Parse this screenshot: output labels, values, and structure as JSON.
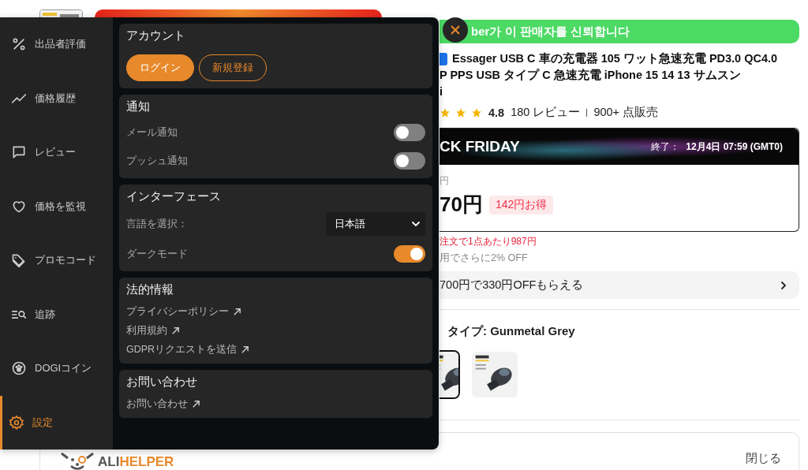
{
  "sidebar": {
    "items": [
      {
        "label": "出品者評価",
        "kind": "percent",
        "selected": false
      },
      {
        "label": "価格履歴",
        "kind": "chart",
        "selected": false
      },
      {
        "label": "レビュー",
        "kind": "chat",
        "selected": false
      },
      {
        "label": "価格を監視",
        "kind": "heart",
        "selected": false
      },
      {
        "label": "プロモコード",
        "kind": "tag",
        "selected": false
      },
      {
        "label": "追跡",
        "kind": "track",
        "selected": false
      },
      {
        "label": "DOGIコイン",
        "kind": "coin",
        "selected": false
      },
      {
        "label": "設定",
        "kind": "gear",
        "selected": true
      }
    ]
  },
  "account": {
    "title": "アカウント",
    "buttons": [
      {
        "label": "ログイン",
        "kind": "primary"
      },
      {
        "label": "新規登録",
        "kind": "outline"
      }
    ]
  },
  "notifications": {
    "title": "通知",
    "toggles": [
      {
        "label": "メール通知",
        "on": false
      },
      {
        "label": "プッシュ通知",
        "on": false
      }
    ]
  },
  "interface": {
    "title": "インターフェース",
    "language": {
      "label": "言語を選択：",
      "value": "日本語"
    },
    "dark_mode": {
      "label": "ダークモード",
      "on": true
    }
  },
  "legal": {
    "title": "法的情報",
    "links": [
      "プライバシーポリシー",
      "利用規約",
      "GDPRリクエストを送信"
    ]
  },
  "contact": {
    "title": "お問い合わせ",
    "links": [
      "お問い合わせ"
    ]
  },
  "product": {
    "trust_banner": "ber가 이 판매자를 신뢰합니다",
    "title_lines": [
      "Essager USB C 車の充電器 105 ワット急速充電 PD3.0 QC4.0",
      "P PPS USB タイプ C 急速充電 iPhone 15 14 13 サムスン",
      "i"
    ],
    "stars": 3,
    "rating": "4.8",
    "reviews": "180 レビュー",
    "sold": "900+ 点販売",
    "sale": {
      "name": "CK FRIDAY",
      "ends_label": "終了：",
      "ends": "12月4日 07:59 (GMT0)",
      "old_price": "円",
      "price": "70円",
      "saving": "142円お得"
    },
    "bulk_note": "注文で1点あたり987円",
    "extra_note": "用でさらに2% OFF",
    "coupon": "700円で330円OFFもらえる",
    "variant_label": "タイプ: Gunmetal Grey",
    "variants": [
      {
        "selected": true
      },
      {
        "selected": false
      }
    ]
  },
  "footer": {
    "logo_plain": "ALI",
    "logo_accent": "HELPER",
    "close": "閉じる"
  }
}
